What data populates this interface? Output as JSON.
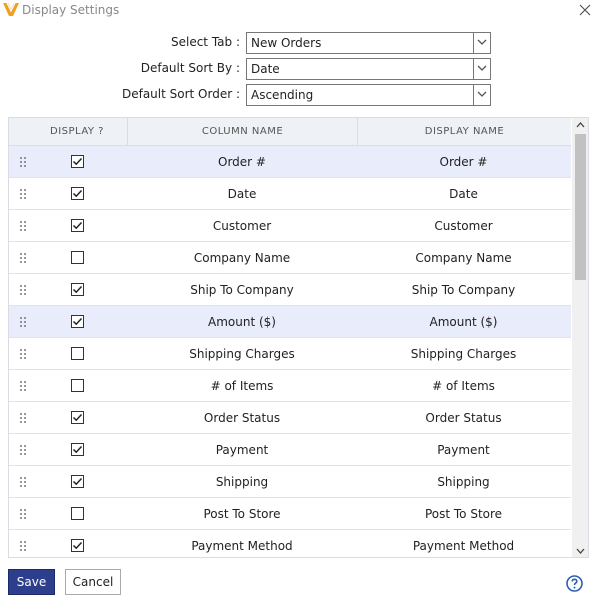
{
  "window": {
    "title": "Display Settings",
    "brand_color": "#f0a020",
    "accent_color": "#2d3e8c"
  },
  "form": {
    "select_tab": {
      "label": "Select Tab :",
      "value": "New Orders"
    },
    "sort_by": {
      "label": "Default Sort By :",
      "value": "Date"
    },
    "sort_order": {
      "label": "Default Sort Order :",
      "value": "Ascending"
    }
  },
  "grid": {
    "headers": {
      "display": "DISPLAY ?",
      "column_name": "COLUMN NAME",
      "display_name": "DISPLAY NAME"
    },
    "rows": [
      {
        "column": "Order #",
        "display": "Order #",
        "checked": true,
        "highlight": true
      },
      {
        "column": "Date",
        "display": "Date",
        "checked": true,
        "highlight": false
      },
      {
        "column": "Customer",
        "display": "Customer",
        "checked": true,
        "highlight": false
      },
      {
        "column": "Company Name",
        "display": "Company Name",
        "checked": false,
        "highlight": false
      },
      {
        "column": "Ship To Company",
        "display": "Ship To Company",
        "checked": true,
        "highlight": false
      },
      {
        "column": "Amount ($)",
        "display": "Amount ($)",
        "checked": true,
        "highlight": true
      },
      {
        "column": "Shipping Charges",
        "display": "Shipping Charges",
        "checked": false,
        "highlight": false
      },
      {
        "column": "# of Items",
        "display": "# of Items",
        "checked": false,
        "highlight": false
      },
      {
        "column": "Order Status",
        "display": "Order Status",
        "checked": true,
        "highlight": false
      },
      {
        "column": "Payment",
        "display": "Payment",
        "checked": true,
        "highlight": false
      },
      {
        "column": "Shipping",
        "display": "Shipping",
        "checked": true,
        "highlight": false
      },
      {
        "column": "Post To Store",
        "display": "Post To Store",
        "checked": false,
        "highlight": false
      },
      {
        "column": "Payment Method",
        "display": "Payment Method",
        "checked": true,
        "highlight": false
      }
    ]
  },
  "footer": {
    "save_label": "Save",
    "cancel_label": "Cancel"
  },
  "icons": {
    "logo": "app-logo-icon",
    "close": "close-icon",
    "dropdown": "chevron-down-icon",
    "drag": "drag-handle-icon",
    "checkbox": "checkbox-icon",
    "help": "help-icon"
  }
}
